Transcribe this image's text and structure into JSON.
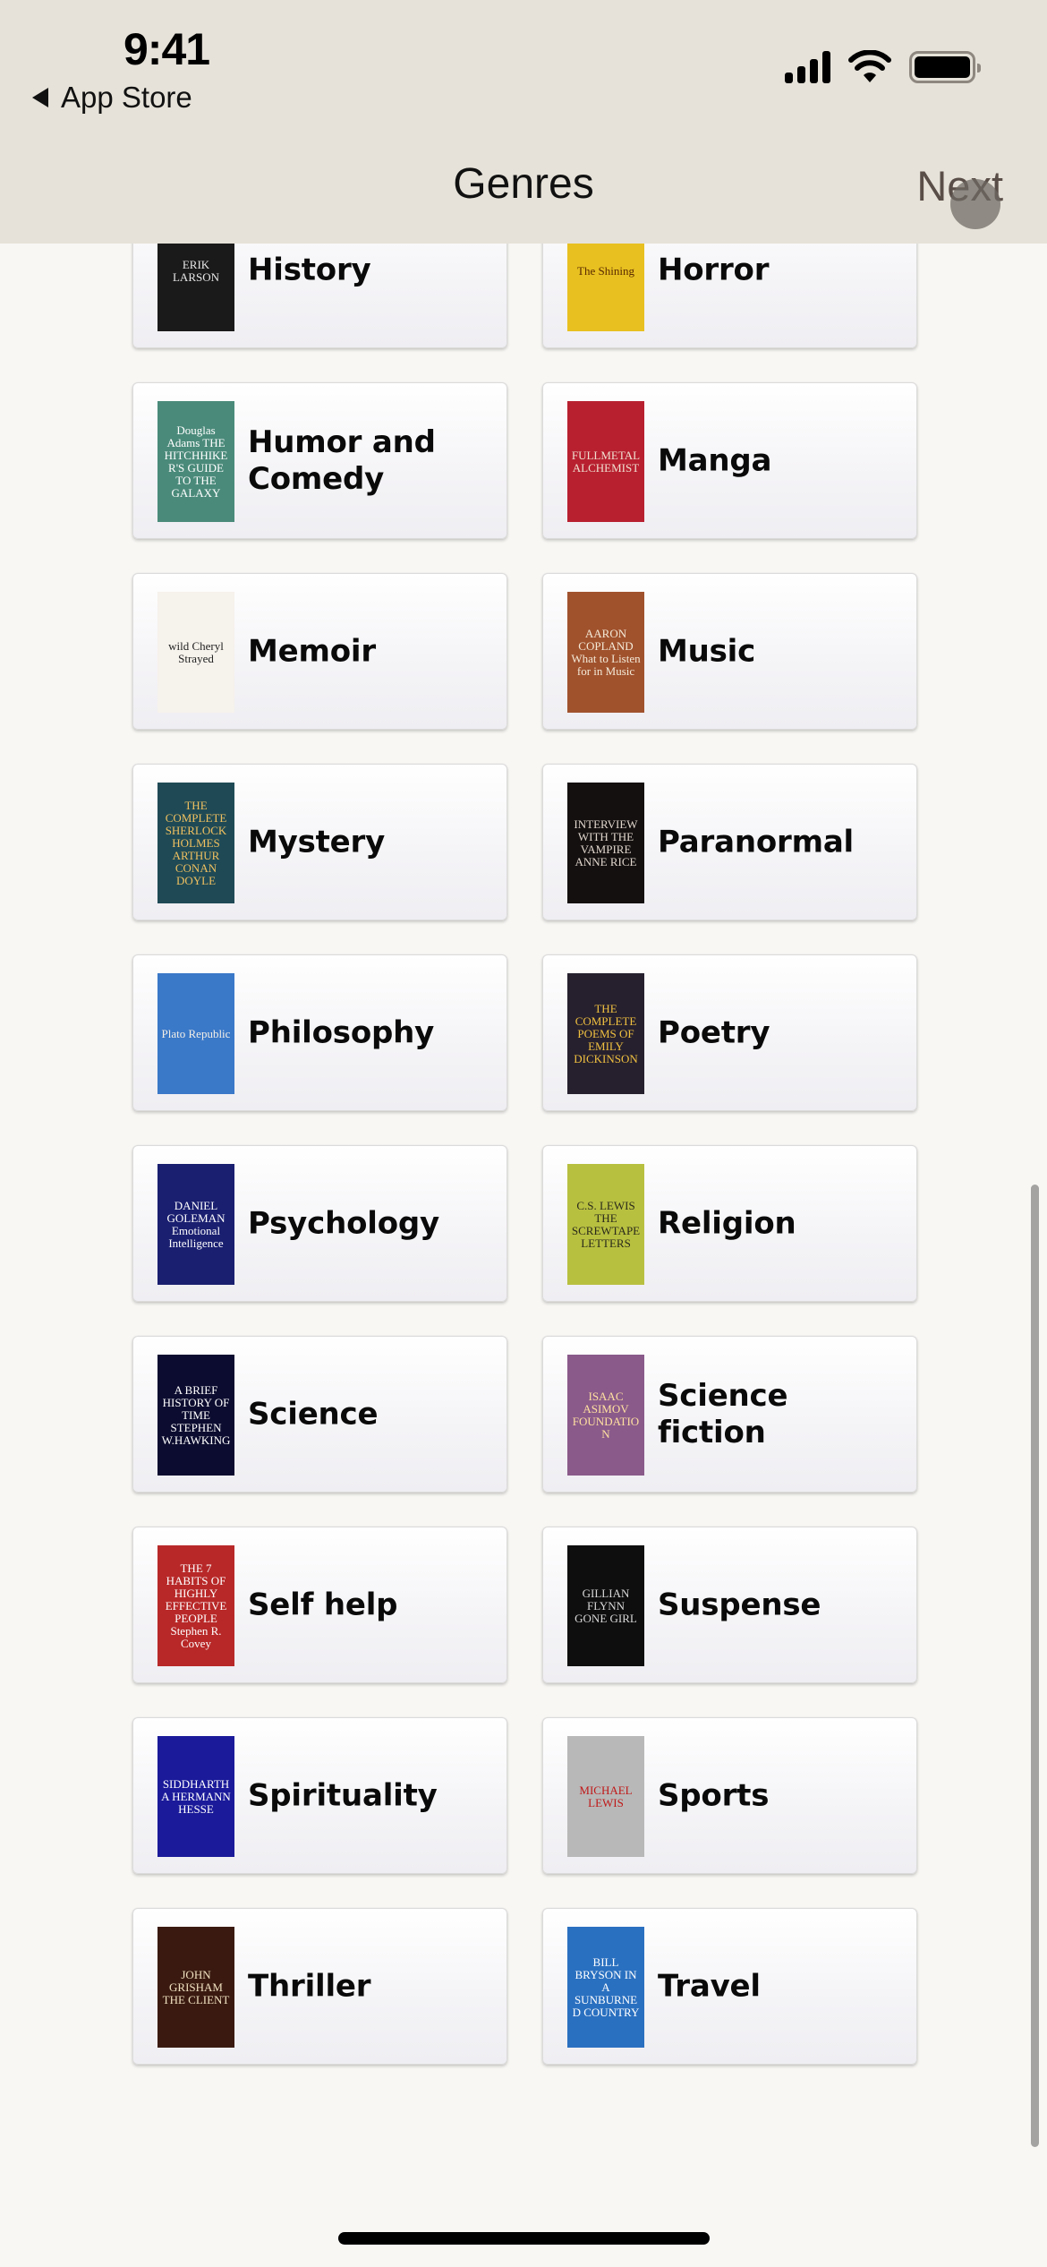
{
  "status_bar": {
    "time": "9:41",
    "back_app": "App Store",
    "icons": [
      "cellular-signal-icon",
      "wifi-icon",
      "battery-icon"
    ]
  },
  "nav": {
    "title": "Genres",
    "next_label": "Next"
  },
  "genres": [
    {
      "label": "History",
      "cover_text": "ERIK LARSON",
      "cover_bg": "#1a1a1a",
      "cover_fg": "#e8e8e8"
    },
    {
      "label": "Horror",
      "cover_text": "The Shining",
      "cover_bg": "#e8c020",
      "cover_fg": "#5a2a00"
    },
    {
      "label": "Humor and Comedy",
      "cover_text": "Douglas Adams THE HITCHHIKER'S GUIDE TO THE GALAXY",
      "cover_bg": "#4a8a7a",
      "cover_fg": "#ffffff"
    },
    {
      "label": "Manga",
      "cover_text": "FULLMETAL ALCHEMIST",
      "cover_bg": "#b82030",
      "cover_fg": "#f0e0d0"
    },
    {
      "label": "Memoir",
      "cover_text": "wild Cheryl Strayed",
      "cover_bg": "#f6f2ec",
      "cover_fg": "#222222"
    },
    {
      "label": "Music",
      "cover_text": "AARON COPLAND What to Listen for in Music",
      "cover_bg": "#a0522d",
      "cover_fg": "#f4ead8"
    },
    {
      "label": "Mystery",
      "cover_text": "THE COMPLETE SHERLOCK HOLMES ARTHUR CONAN DOYLE",
      "cover_bg": "#1f4a55",
      "cover_fg": "#f0c060"
    },
    {
      "label": "Paranormal",
      "cover_text": "INTERVIEW WITH THE VAMPIRE ANNE RICE",
      "cover_bg": "#141010",
      "cover_fg": "#e0d6cc"
    },
    {
      "label": "Philosophy",
      "cover_text": "Plato Republic",
      "cover_bg": "#3a78c8",
      "cover_fg": "#f4efe6"
    },
    {
      "label": "Poetry",
      "cover_text": "THE COMPLETE POEMS OF EMILY DICKINSON",
      "cover_bg": "#26202e",
      "cover_fg": "#f0c040"
    },
    {
      "label": "Psychology",
      "cover_text": "DANIEL GOLEMAN Emotional Intelligence",
      "cover_bg": "#1a1f70",
      "cover_fg": "#ffffff"
    },
    {
      "label": "Religion",
      "cover_text": "C.S. LEWIS THE SCREWTAPE LETTERS",
      "cover_bg": "#b8c040",
      "cover_fg": "#2a2a1a"
    },
    {
      "label": "Science",
      "cover_text": "A BRIEF HISTORY OF TIME STEPHEN W.HAWKING",
      "cover_bg": "#0c0c30",
      "cover_fg": "#ffffff"
    },
    {
      "label": "Science fiction",
      "cover_text": "ISAAC ASIMOV FOUNDATION",
      "cover_bg": "#8a5a8a",
      "cover_fg": "#ffe0a0"
    },
    {
      "label": "Self help",
      "cover_text": "THE 7 HABITS OF HIGHLY EFFECTIVE PEOPLE Stephen R. Covey",
      "cover_bg": "#b82828",
      "cover_fg": "#ffffff"
    },
    {
      "label": "Suspense",
      "cover_text": "GILLIAN FLYNN GONE GIRL",
      "cover_bg": "#0e0e0e",
      "cover_fg": "#d8d8d8"
    },
    {
      "label": "Spirituality",
      "cover_text": "SIDDHARTHA HERMANN HESSE",
      "cover_bg": "#1a1a9a",
      "cover_fg": "#ffffff"
    },
    {
      "label": "Sports",
      "cover_text": "MICHAEL LEWIS",
      "cover_bg": "#b8b8b8",
      "cover_fg": "#c01818"
    },
    {
      "label": "Thriller",
      "cover_text": "JOHN GRISHAM THE CLIENT",
      "cover_bg": "#3a1a10",
      "cover_fg": "#f0e0c0"
    },
    {
      "label": "Travel",
      "cover_text": "BILL BRYSON IN A SUNBURNED COUNTRY",
      "cover_bg": "#2a70c0",
      "cover_fg": "#ffffff"
    }
  ]
}
